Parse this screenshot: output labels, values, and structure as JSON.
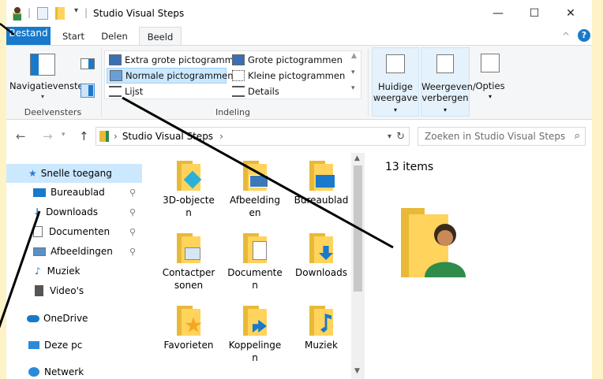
{
  "window": {
    "title": "Studio Visual Steps",
    "controls": {
      "minimize": "—",
      "maximize": "☐",
      "close": "✕"
    },
    "collapse_ribbon": "^",
    "help": "?"
  },
  "ribbon": {
    "tabs": [
      {
        "label": "Bestand"
      },
      {
        "label": "Start"
      },
      {
        "label": "Delen"
      },
      {
        "label": "Beeld"
      }
    ],
    "navigation": {
      "button_label": "Navigatievenster",
      "group_label": "Deelvensters"
    },
    "layout": {
      "group_label": "Indeling",
      "options": [
        "Extra grote pictogrammen",
        "Grote pictogrammen",
        "Normale pictogrammen",
        "Kleine pictogrammen",
        "Lijst",
        "Details"
      ],
      "selected": "Normale pictogrammen"
    },
    "current_view": {
      "line1": "Huidige",
      "line2": "weergave"
    },
    "show_hide": {
      "line1": "Weergeven/",
      "line2": "verbergen"
    },
    "options": {
      "label": "Opties"
    }
  },
  "address": {
    "path": [
      "Studio Visual Steps"
    ],
    "search_placeholder": "Zoeken in Studio Visual Steps"
  },
  "nav_pane": {
    "items": [
      {
        "label": "Snelle toegang",
        "icon": "star-icon"
      },
      {
        "label": "Bureaublad",
        "icon": "desktop-icon",
        "pinned": true
      },
      {
        "label": "Downloads",
        "icon": "download-icon",
        "pinned": true
      },
      {
        "label": "Documenten",
        "icon": "document-icon",
        "pinned": true
      },
      {
        "label": "Afbeeldingen",
        "icon": "picture-icon",
        "pinned": true
      },
      {
        "label": "Muziek",
        "icon": "music-icon"
      },
      {
        "label": "Video's",
        "icon": "video-icon"
      },
      {
        "label": "OneDrive",
        "icon": "cloud-icon"
      },
      {
        "label": "Deze pc",
        "icon": "pc-icon"
      },
      {
        "label": "Netwerk",
        "icon": "network-icon"
      }
    ]
  },
  "files": [
    {
      "line1": "3D-objecte",
      "line2": "n",
      "badge": "cube"
    },
    {
      "line1": "Afbeelding",
      "line2": "en",
      "badge": "picture"
    },
    {
      "line1": "Bureaublad",
      "line2": "",
      "badge": "desktop"
    },
    {
      "line1": "Contactper",
      "line2": "sonen",
      "badge": "contact"
    },
    {
      "line1": "Documente",
      "line2": "n",
      "badge": "document"
    },
    {
      "line1": "Downloads",
      "line2": "",
      "badge": "download"
    },
    {
      "line1": "Favorieten",
      "line2": "",
      "badge": "star"
    },
    {
      "line1": "Koppelinge",
      "line2": "n",
      "badge": "link"
    },
    {
      "line1": "Muziek",
      "line2": "",
      "badge": "music"
    }
  ],
  "preview": {
    "count_text": "13 items"
  },
  "colors": {
    "accent": "#1979ca",
    "selection": "#cce8ff",
    "folder": "#ffd35c",
    "annotation_bg": "#fdf3c6"
  }
}
